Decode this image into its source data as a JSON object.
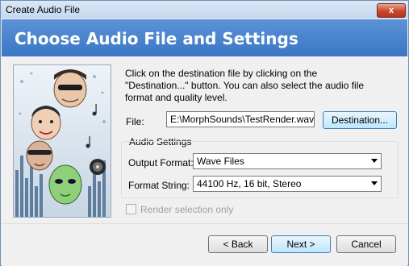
{
  "window": {
    "title": "Create Audio File",
    "close_label": "x"
  },
  "header": {
    "title": "Choose Audio File and Settings"
  },
  "main": {
    "description": "Click on the destination file by clicking on the\n\"Destination...\" button.  You can also select the audio file\nformat and quality level.",
    "file_label": "File:",
    "file_value": "E:\\MorphSounds\\TestRender.wav",
    "destination_button": "Destination..."
  },
  "audio_settings": {
    "legend": "Audio Settings",
    "output_format_label": "Output Format:",
    "output_format_value": "Wave Files",
    "format_string_label": "Format String:",
    "format_string_value": "44100 Hz, 16 bit, Stereo"
  },
  "options": {
    "render_selection_label": "Render selection only",
    "render_selection_checked": false,
    "render_selection_enabled": false
  },
  "footer": {
    "back_label": "< Back",
    "next_label": "Next >",
    "cancel_label": "Cancel"
  },
  "colors": {
    "header_bg": "#3a76c5",
    "close_btn": "#c9462c"
  }
}
